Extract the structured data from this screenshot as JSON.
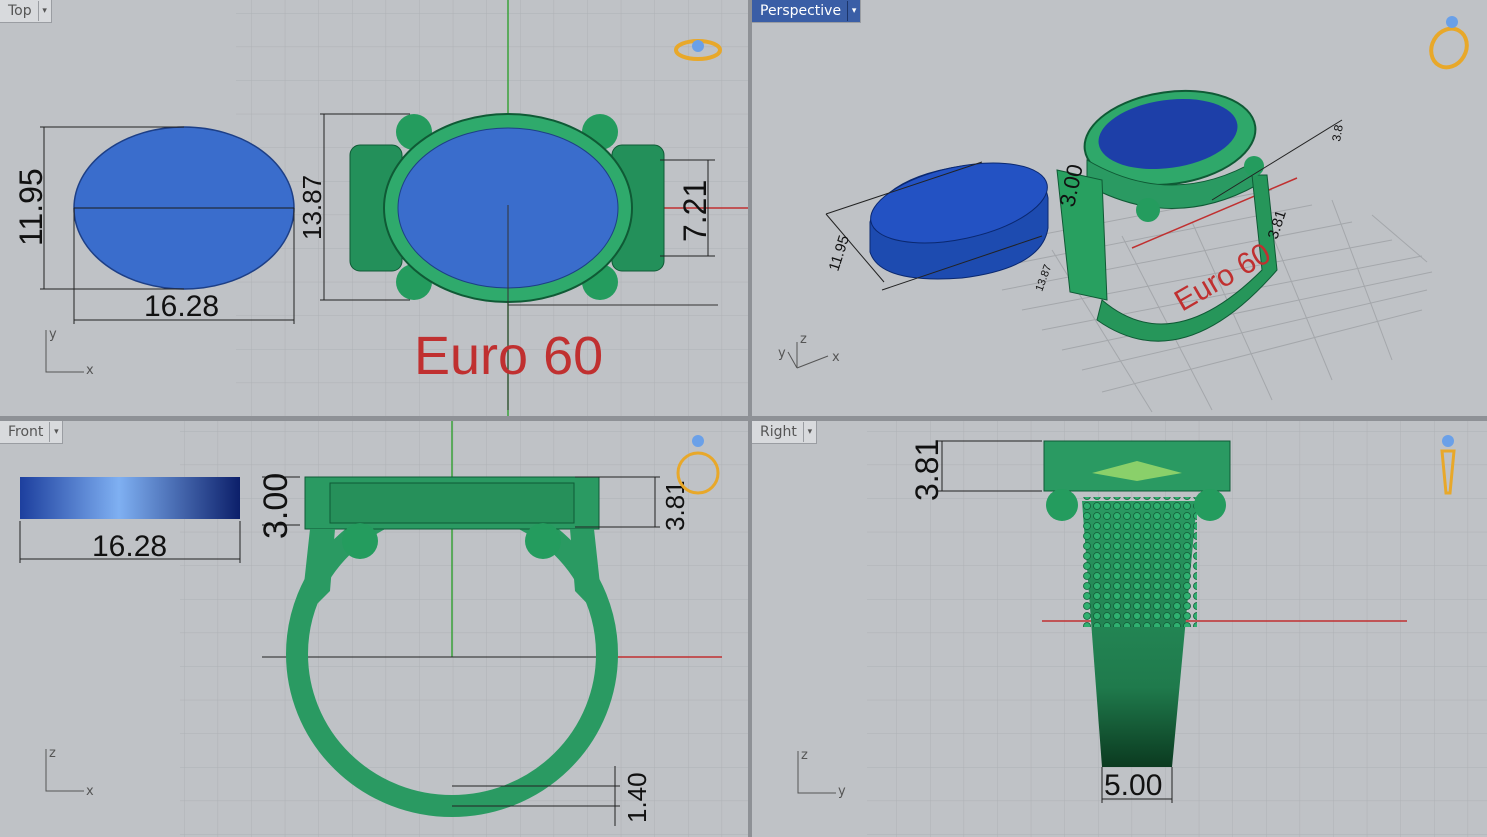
{
  "viewports": [
    {
      "id": "top",
      "label": "Top",
      "active": false
    },
    {
      "id": "perspective",
      "label": "Perspective",
      "active": true
    },
    {
      "id": "front",
      "label": "Front",
      "active": false
    },
    {
      "id": "right",
      "label": "Right",
      "active": false
    }
  ],
  "menu_arrow": "▾",
  "top": {
    "dim_height": "11.95",
    "dim_width": "16.28",
    "dim_ring_height": "13.87",
    "dim_side": "7.21",
    "watermark": "Euro 60",
    "axis_v": "y",
    "axis_h": "x"
  },
  "perspective": {
    "dim_a": "11.95",
    "dim_b": "3.00",
    "dim_c": "13.87",
    "dim_d": "3.81",
    "dim_e": "3.8",
    "watermark": "Euro 60",
    "axis_v": "z",
    "axis_y": "y",
    "axis_h": "x"
  },
  "front": {
    "dim_width": "16.28",
    "dim_bezel": "3.00",
    "dim_band": "3.81",
    "dim_bottom": "1.40",
    "axis_v": "z",
    "axis_h": "x"
  },
  "right": {
    "dim_top": "3.81",
    "dim_bottom": "5.00",
    "axis_v": "z",
    "axis_h": "y"
  },
  "colors": {
    "ring": "#2a9a62",
    "stone": "#3a6dcc",
    "accent": "#c03030"
  }
}
